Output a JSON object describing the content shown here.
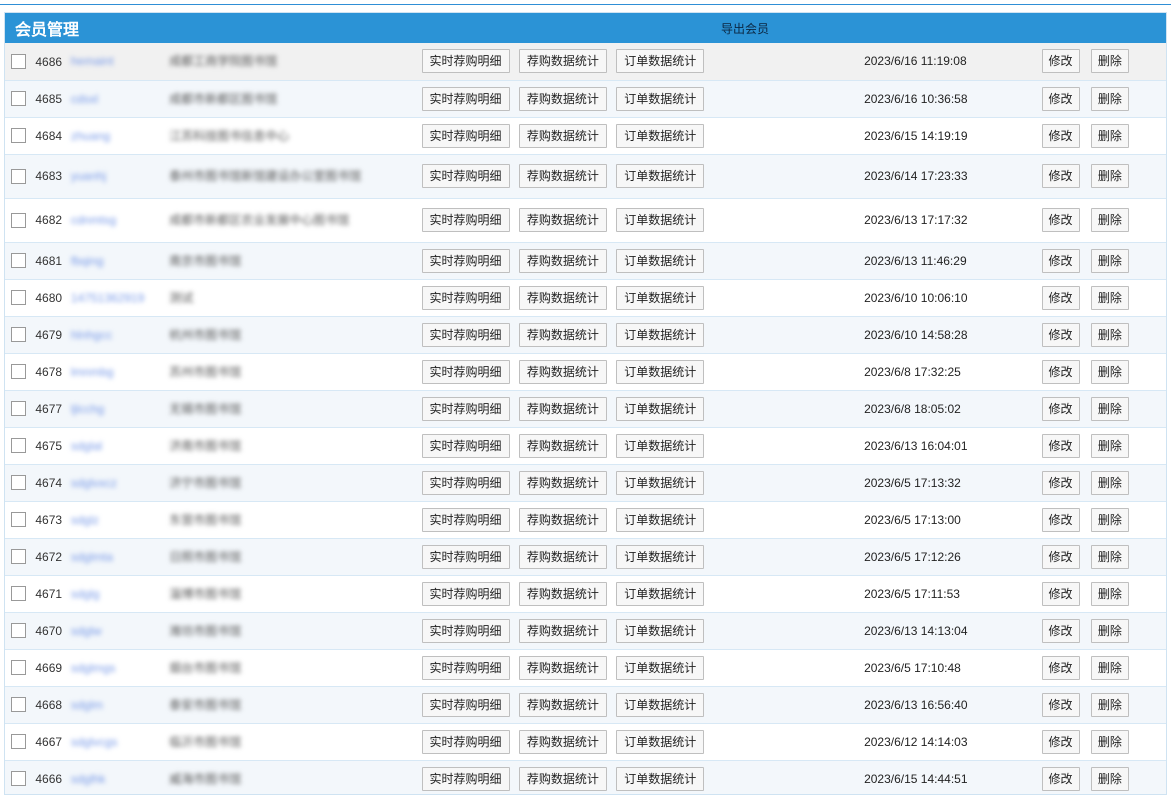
{
  "header": {
    "title": "会员管理",
    "export_label": "导出会员"
  },
  "actions": {
    "detail": "实时荐购明细",
    "stats": "荐购数据统计",
    "order": "订单数据统计",
    "edit": "修改",
    "delete": "删除"
  },
  "rows": [
    {
      "id": "4686",
      "username": "hemaint",
      "name": "成都工商学院图书馆",
      "time": "2023/6/16 11:19:08"
    },
    {
      "id": "4685",
      "username": "cdsxl",
      "name": "成都市新都区图书馆",
      "time": "2023/6/16 10:36:58"
    },
    {
      "id": "4684",
      "username": "zhuang",
      "name": "江苏科技图书信息中心",
      "time": "2023/6/15 14:19:19"
    },
    {
      "id": "4683",
      "username": "yuanhj",
      "name": "泰州市图书馆新馆建设办公室图书馆",
      "time": "2023/6/14 17:23:33"
    },
    {
      "id": "4682",
      "username": "cdnmtsg",
      "name": "成都市新都区农业发展中心图书馆",
      "time": "2023/6/13 17:17:32"
    },
    {
      "id": "4681",
      "username": "fbqing",
      "name": "南京市图书馆",
      "time": "2023/6/13 11:46:29"
    },
    {
      "id": "4680",
      "username": "14751362919",
      "name": "测试",
      "time": "2023/6/10 10:06:10"
    },
    {
      "id": "4679",
      "username": "hlnhgcc",
      "name": "杭州市图书馆",
      "time": "2023/6/10 14:58:28"
    },
    {
      "id": "4678",
      "username": "lmnmbg",
      "name": "苏州市图书馆",
      "time": "2023/6/8 17:32:25"
    },
    {
      "id": "4677",
      "username": "ljlcchg",
      "name": "无锡市图书馆",
      "time": "2023/6/8 18:05:02"
    },
    {
      "id": "4675",
      "username": "sdglal",
      "name": "济南市图书馆",
      "time": "2023/6/13 16:04:01"
    },
    {
      "id": "4674",
      "username": "sdglvxcz",
      "name": "济宁市图书馆",
      "time": "2023/6/5 17:13:32"
    },
    {
      "id": "4673",
      "username": "sdglz",
      "name": "东营市图书馆",
      "time": "2023/6/5 17:13:00"
    },
    {
      "id": "4672",
      "username": "sdglmta",
      "name": "日照市图书馆",
      "time": "2023/6/5 17:12:26"
    },
    {
      "id": "4671",
      "username": "sdglg",
      "name": "淄博市图书馆",
      "time": "2023/6/5 17:11:53"
    },
    {
      "id": "4670",
      "username": "sdglw",
      "name": "潍坊市图书馆",
      "time": "2023/6/13 14:13:04"
    },
    {
      "id": "4669",
      "username": "sdglmgs",
      "name": "烟台市图书馆",
      "time": "2023/6/5 17:10:48"
    },
    {
      "id": "4668",
      "username": "sdglm",
      "name": "泰安市图书馆",
      "time": "2023/6/13 16:56:40"
    },
    {
      "id": "4667",
      "username": "sdglvcgs",
      "name": "临沂市图书馆",
      "time": "2023/6/12 14:14:03"
    },
    {
      "id": "4666",
      "username": "sdglhk",
      "name": "威海市图书馆",
      "time": "2023/6/15 14:44:51"
    }
  ],
  "colors": {
    "header_bg": "#2b93d6",
    "row_alt": "#f3f7fb",
    "row_border": "#d7e8f5"
  }
}
